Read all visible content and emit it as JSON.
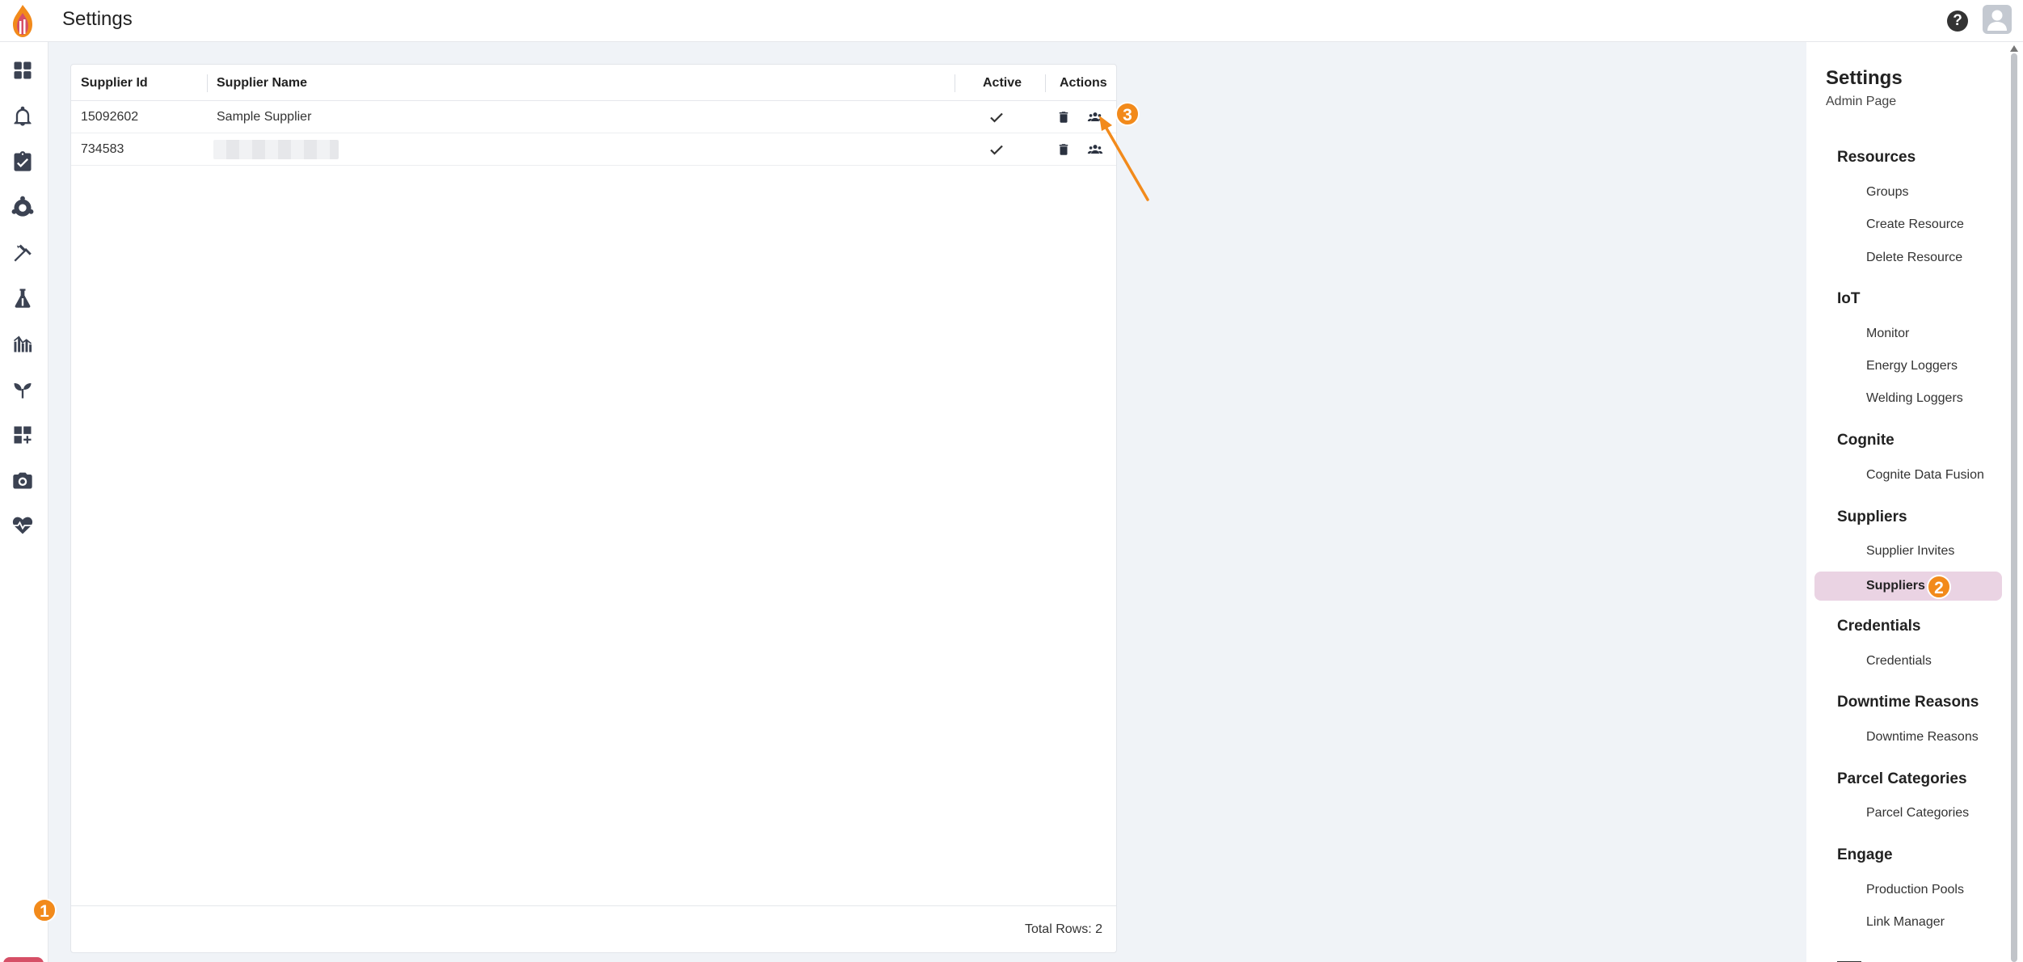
{
  "header": {
    "title": "Settings",
    "help_icon": "help-icon",
    "avatar_icon": "account-icon"
  },
  "colors": {
    "accent": "#d64f66",
    "badge": "#f28a1b",
    "active_item_bg": "#ead3e3"
  },
  "rail": {
    "icons": [
      "dashboard-icon",
      "bell-icon",
      "clipboard-icon",
      "process-icon",
      "tools-icon",
      "flask-icon",
      "analytics-icon",
      "sprout-icon",
      "add-widget-icon",
      "camera-icon",
      "health-icon"
    ],
    "settings_icon": "gear-icon"
  },
  "badges": {
    "step1": "1",
    "step2": "2",
    "step3": "3"
  },
  "table": {
    "columns": [
      "Supplier Id",
      "Supplier Name",
      "Active",
      "Actions"
    ],
    "rows": [
      {
        "id": "15092602",
        "name": "Sample Supplier",
        "active": true
      },
      {
        "id": "734583",
        "name": "",
        "active": true
      }
    ],
    "footer": "Total Rows: 2"
  },
  "settings_panel": {
    "title": "Settings",
    "subtitle": "Admin Page",
    "sections": [
      {
        "label": "Resources",
        "items": [
          "Groups",
          "Create Resource",
          "Delete Resource"
        ]
      },
      {
        "label": "IoT",
        "items": [
          "Monitor",
          "Energy Loggers",
          "Welding Loggers"
        ]
      },
      {
        "label": "Cognite",
        "items": [
          "Cognite Data Fusion"
        ]
      },
      {
        "label": "Suppliers",
        "items": [
          "Supplier Invites",
          "Suppliers"
        ]
      },
      {
        "label": "Credentials",
        "items": [
          "Credentials"
        ]
      },
      {
        "label": "Downtime Reasons",
        "items": [
          "Downtime Reasons"
        ]
      },
      {
        "label": "Parcel Categories",
        "items": [
          "Parcel Categories"
        ]
      },
      {
        "label": "Engage",
        "items": [
          "Production Pools",
          "Link Manager"
        ]
      }
    ],
    "active_item": "Suppliers"
  }
}
